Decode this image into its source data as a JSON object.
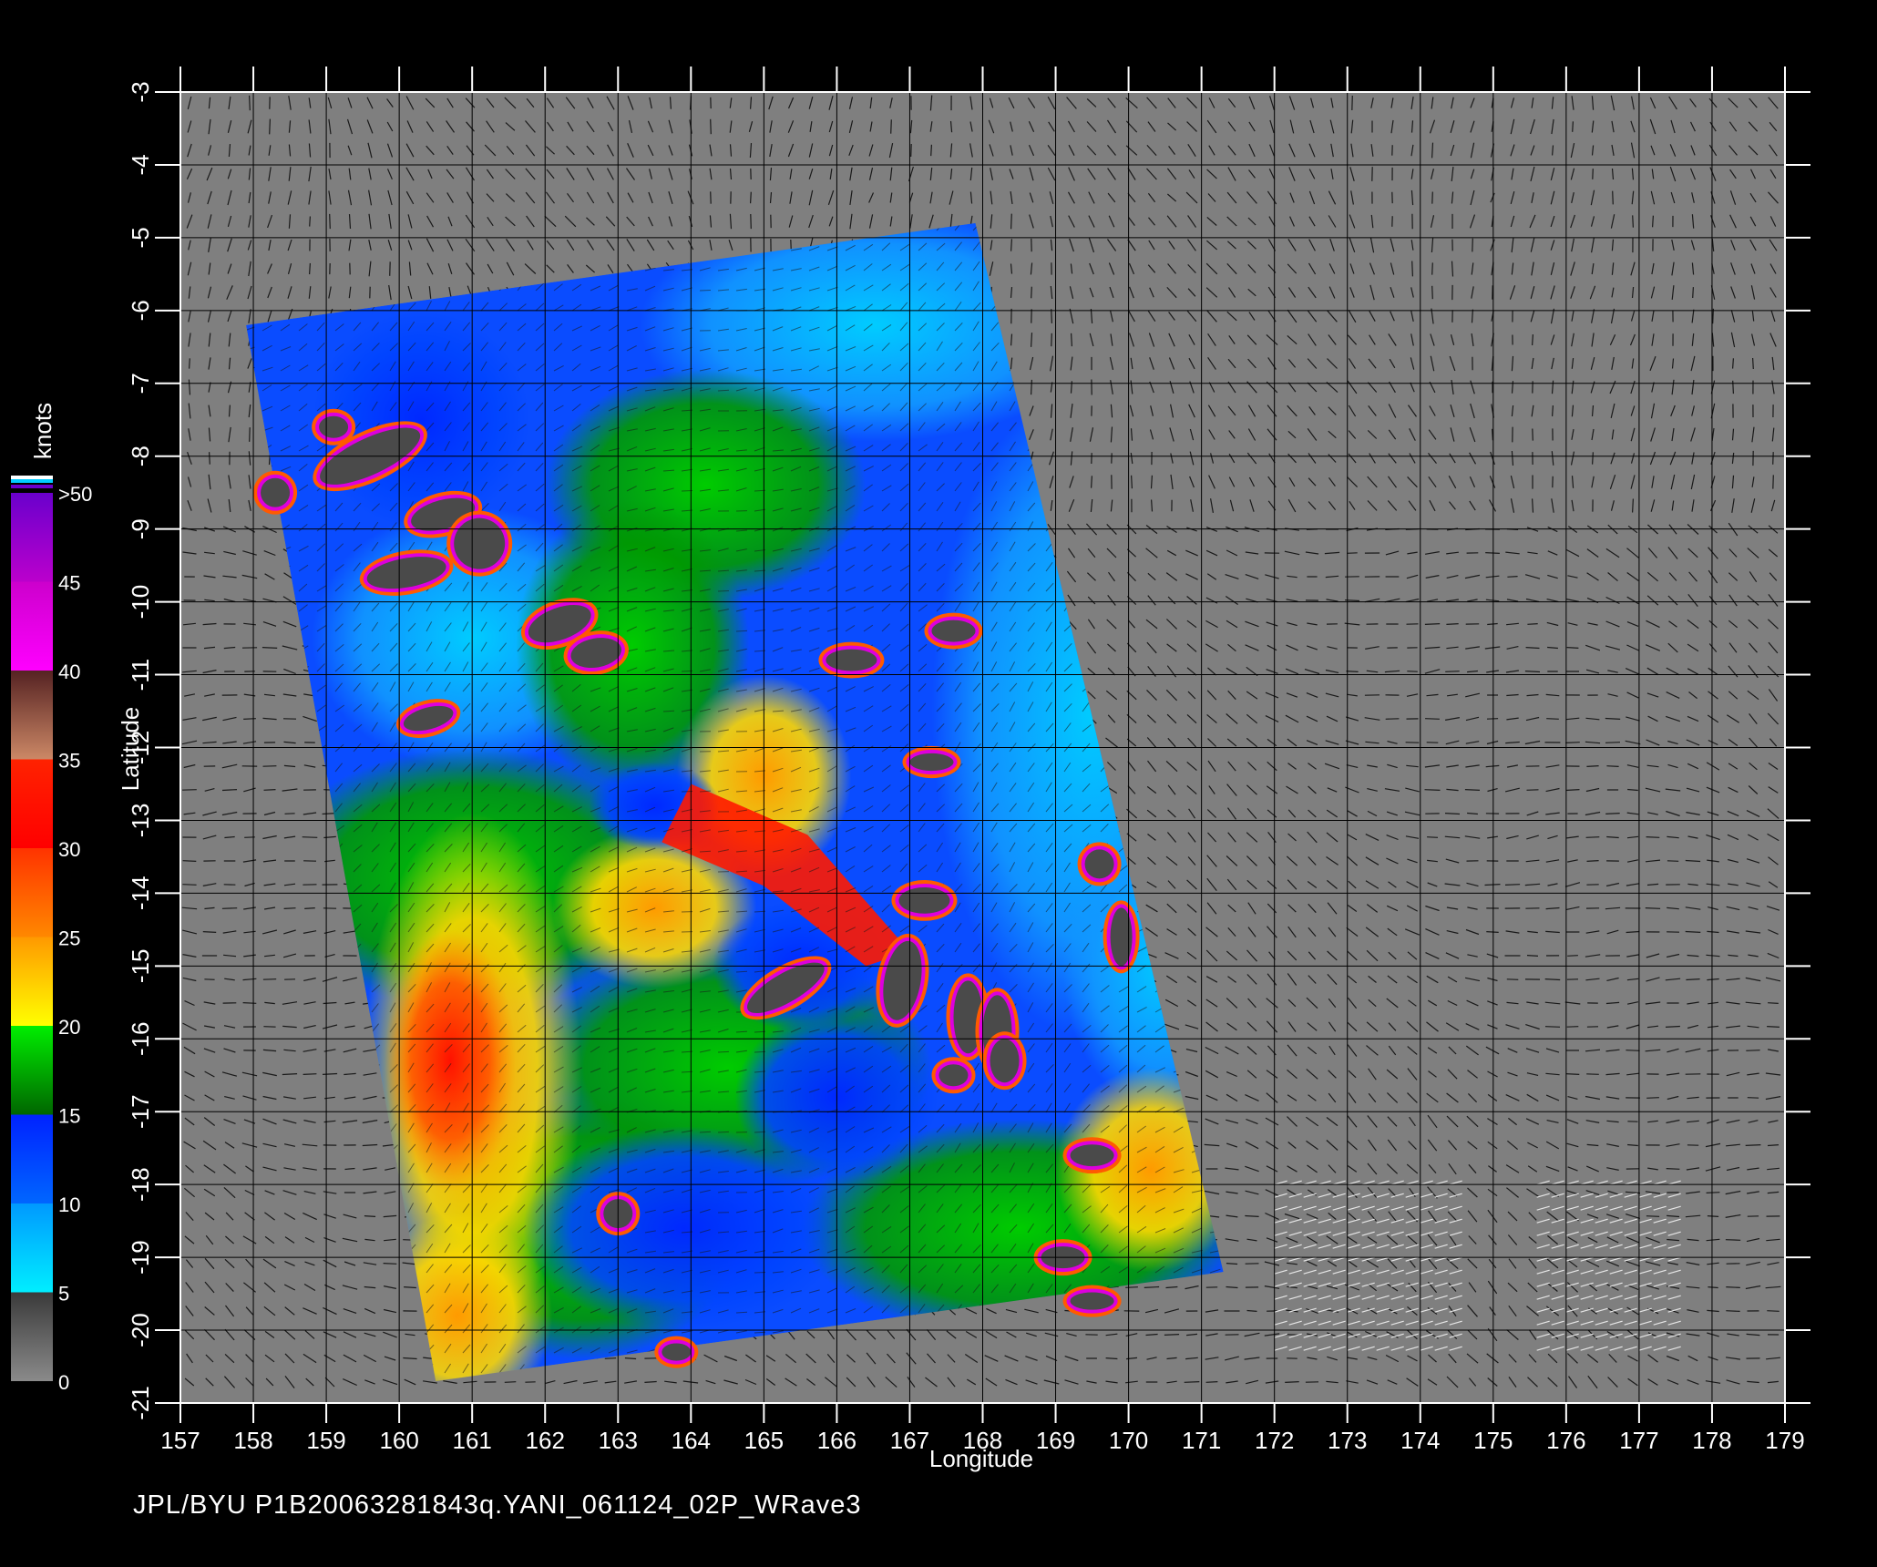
{
  "map": {
    "title": "",
    "x_axis": {
      "label": "Longitude",
      "range": [
        157,
        179
      ],
      "ticks": [
        "157",
        "158",
        "159",
        "160",
        "161",
        "162",
        "163",
        "164",
        "165",
        "166",
        "167",
        "168",
        "169",
        "170",
        "171",
        "172",
        "173",
        "174",
        "175",
        "176",
        "177",
        "178",
        "179"
      ]
    },
    "y_axis": {
      "label": "Latitude",
      "range": [
        -21,
        -3
      ],
      "ticks": [
        "-3",
        "-4",
        "-5",
        "-6",
        "-7",
        "-8",
        "-9",
        "-10",
        "-11",
        "-12",
        "-13",
        "-14",
        "-15",
        "-16",
        "-17",
        "-18",
        "-19",
        "-20",
        "-21"
      ]
    },
    "grid": true,
    "background_color": "#7f7f7f",
    "land_color": "#4a4a4a",
    "swath_corners_lonlat": [
      [
        157.9,
        -6.2
      ],
      [
        167.9,
        -4.8
      ],
      [
        171.3,
        -19.2
      ],
      [
        160.5,
        -20.7
      ]
    ]
  },
  "colorbar": {
    "title": "knots",
    "labels": [
      ">50",
      "45",
      "40",
      "35",
      "30",
      "25",
      "20",
      "15",
      "10",
      "5",
      "0"
    ],
    "stops": [
      {
        "from": 0,
        "to": 5,
        "colors": [
          "#8a8a8a",
          "#3a3a3a"
        ]
      },
      {
        "from": 5,
        "to": 10,
        "colors": [
          "#00eeff",
          "#0099ff"
        ]
      },
      {
        "from": 10,
        "to": 15,
        "colors": [
          "#0066ff",
          "#0022ff"
        ]
      },
      {
        "from": 15,
        "to": 20,
        "colors": [
          "#006600",
          "#00ee00"
        ]
      },
      {
        "from": 20,
        "to": 25,
        "colors": [
          "#ffff00",
          "#ff9900"
        ]
      },
      {
        "from": 25,
        "to": 30,
        "colors": [
          "#ff8800",
          "#ff3300"
        ]
      },
      {
        "from": 30,
        "to": 35,
        "colors": [
          "#ff0000",
          "#ff2200"
        ]
      },
      {
        "from": 35,
        "to": 40,
        "colors": [
          "#cc8866",
          "#552222"
        ]
      },
      {
        "from": 40,
        "to": 45,
        "colors": [
          "#ff00ff",
          "#cc00cc"
        ]
      },
      {
        "from": 45,
        "to": 50,
        "colors": [
          "#bb00cc",
          "#6a00cc"
        ]
      }
    ]
  },
  "footer": "JPL/BYU  P1B20063281843q.YANI_061124_02P_WRave3"
}
